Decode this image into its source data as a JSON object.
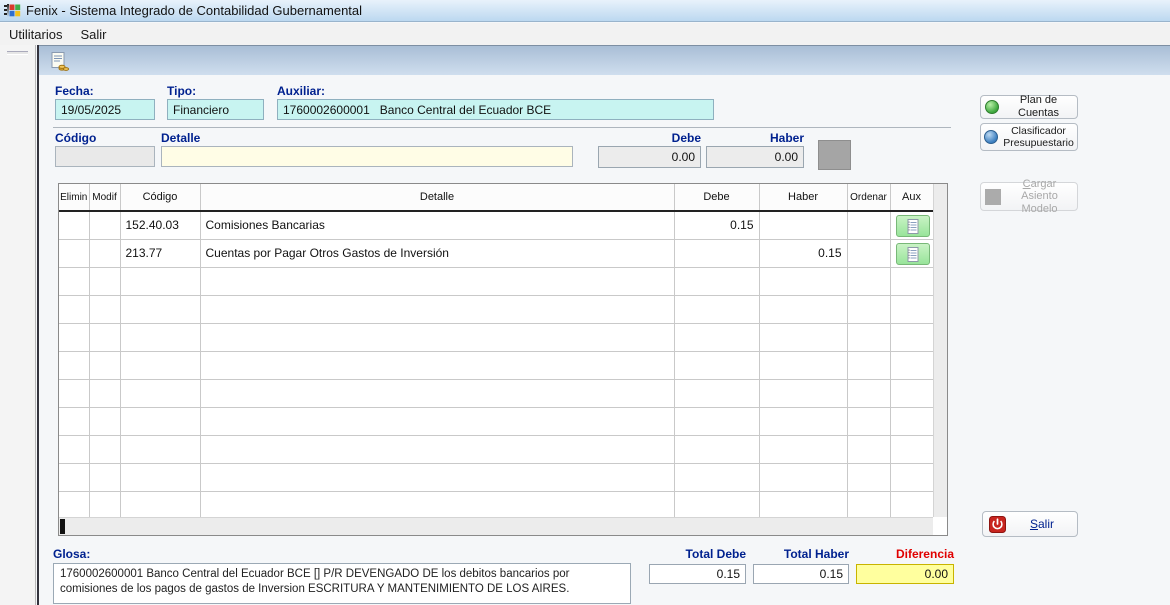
{
  "window": {
    "title": "Fenix - Sistema Integrado de Contabilidad Gubernamental"
  },
  "menu": {
    "items": [
      "Utilitarios",
      "Salir"
    ]
  },
  "toolbar": {
    "new_entry_icon": "document-coins-icon"
  },
  "form": {
    "fecha_label": "Fecha:",
    "fecha_value": "19/05/2025",
    "tipo_label": "Tipo:",
    "tipo_value": "Financiero",
    "auxiliar_label": "Auxiliar:",
    "auxiliar_value": "1760002600001   Banco Central del Ecuador BCE",
    "codigo_label": "Código",
    "codigo_value": "",
    "detalle_label": "Detalle",
    "detalle_value": "",
    "debe_label": "Debe",
    "debe_value": "0.00",
    "haber_label": "Haber",
    "haber_value": "0.00"
  },
  "grid": {
    "headers": [
      "Elimin",
      "Modif",
      "Código",
      "Detalle",
      "Debe",
      "Haber",
      "Ordenar",
      "Aux"
    ],
    "rows": [
      {
        "codigo": "152.40.03",
        "detalle": "Comisiones Bancarias",
        "debe": "0.15",
        "haber": ""
      },
      {
        "codigo": "213.77",
        "detalle": "Cuentas por Pagar Otros Gastos de Inversión",
        "debe": "",
        "haber": "0.15"
      }
    ],
    "aux_icon": "notepad-icon"
  },
  "side": {
    "plan_label": "Plan de Cuentas",
    "clasificador_line1": "Clasificador",
    "clasificador_line2": "Presupuestario",
    "cargar_line1": "Cargar Asiento",
    "cargar_line2": "Modelo",
    "salir_label": "Salir"
  },
  "footer": {
    "glosa_label": "Glosa:",
    "glosa_value": "1760002600001 Banco Central del Ecuador BCE  [] P/R DEVENGADO DE  los debitos bancarios por comisiones de los pagos de gastos de Inversion ESCRITURA Y MANTENIMIENTO DE LOS AIRES.",
    "total_debe_label": "Total Debe",
    "total_debe_value": "0.15",
    "total_haber_label": "Total Haber",
    "total_haber_value": "0.15",
    "diferencia_label": "Diferencia",
    "diferencia_value": "0.00"
  },
  "colors": {
    "label_navy": "#00218f",
    "field_cyan": "#c8f4f1",
    "field_yellow": "#fffde6",
    "diferencia_yellow": "#ffff9e",
    "diferencia_red": "#e00000",
    "aux_green": "#98e49a",
    "toolbar_blue": "#a9bed6",
    "disabled_gray": "#a8a8a8"
  }
}
